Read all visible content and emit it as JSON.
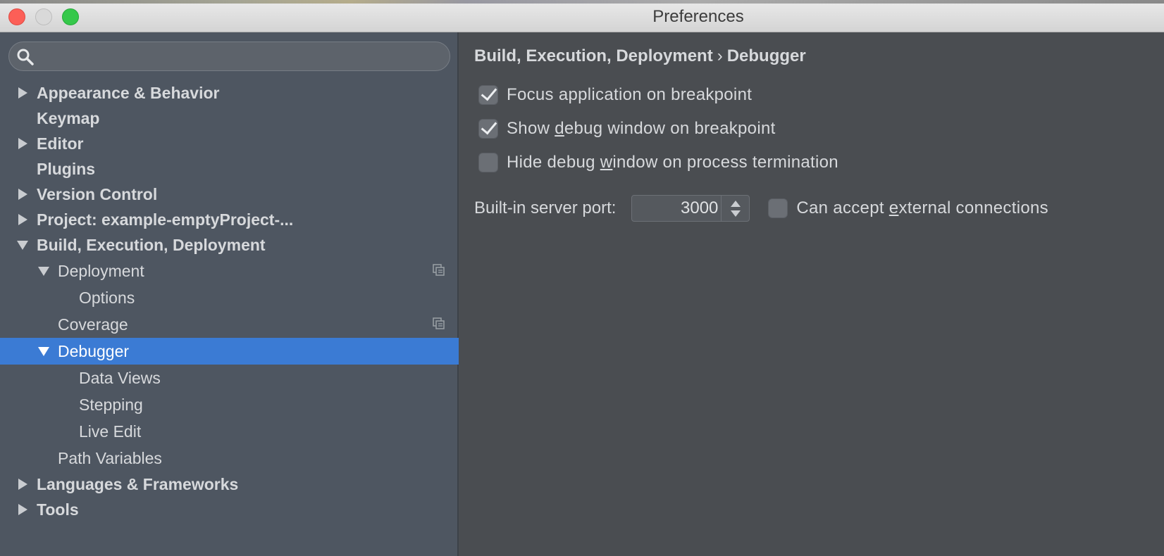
{
  "window": {
    "title": "Preferences"
  },
  "search": {
    "placeholder": "",
    "value": ""
  },
  "tree": [
    {
      "label": "Appearance & Behavior",
      "arrow": "right"
    },
    {
      "label": "Keymap",
      "arrow": "none"
    },
    {
      "label": "Editor",
      "arrow": "right"
    },
    {
      "label": "Plugins",
      "arrow": "none"
    },
    {
      "label": "Version Control",
      "arrow": "right"
    },
    {
      "label": "Project: example-emptyProject-...",
      "arrow": "right"
    },
    {
      "label": "Build, Execution, Deployment",
      "arrow": "down"
    },
    {
      "label": "Deployment",
      "arrow": "down"
    },
    {
      "label": "Options",
      "arrow": "none"
    },
    {
      "label": "Coverage",
      "arrow": "none"
    },
    {
      "label": "Debugger",
      "arrow": "down",
      "selected": true
    },
    {
      "label": "Data Views",
      "arrow": "none"
    },
    {
      "label": "Stepping",
      "arrow": "none"
    },
    {
      "label": "Live Edit",
      "arrow": "none"
    },
    {
      "label": "Path Variables",
      "arrow": "none"
    },
    {
      "label": "Languages & Frameworks",
      "arrow": "right"
    },
    {
      "label": "Tools",
      "arrow": "right"
    }
  ],
  "breadcrumb": {
    "parent": "Build, Execution, Deployment",
    "separator": "›",
    "current": "Debugger"
  },
  "options": {
    "focus_app": {
      "label": "Focus application on breakpoint",
      "checked": true
    },
    "show_debug": {
      "label_pre": "Show ",
      "label_mnemonic": "d",
      "label_post": "ebug window on breakpoint",
      "checked": true
    },
    "hide_debug": {
      "label_pre": "Hide debug ",
      "label_mnemonic": "w",
      "label_post": "indow on process termination",
      "checked": false
    }
  },
  "port": {
    "label": "Built-in server port:",
    "value": "3000",
    "external": {
      "label_pre": "Can accept ",
      "label_mnemonic": "e",
      "label_post": "xternal connections",
      "checked": false
    }
  },
  "colors": {
    "selection": "#3b7bd4",
    "sidebar": "#4e5661",
    "panel": "#4a4d51"
  }
}
